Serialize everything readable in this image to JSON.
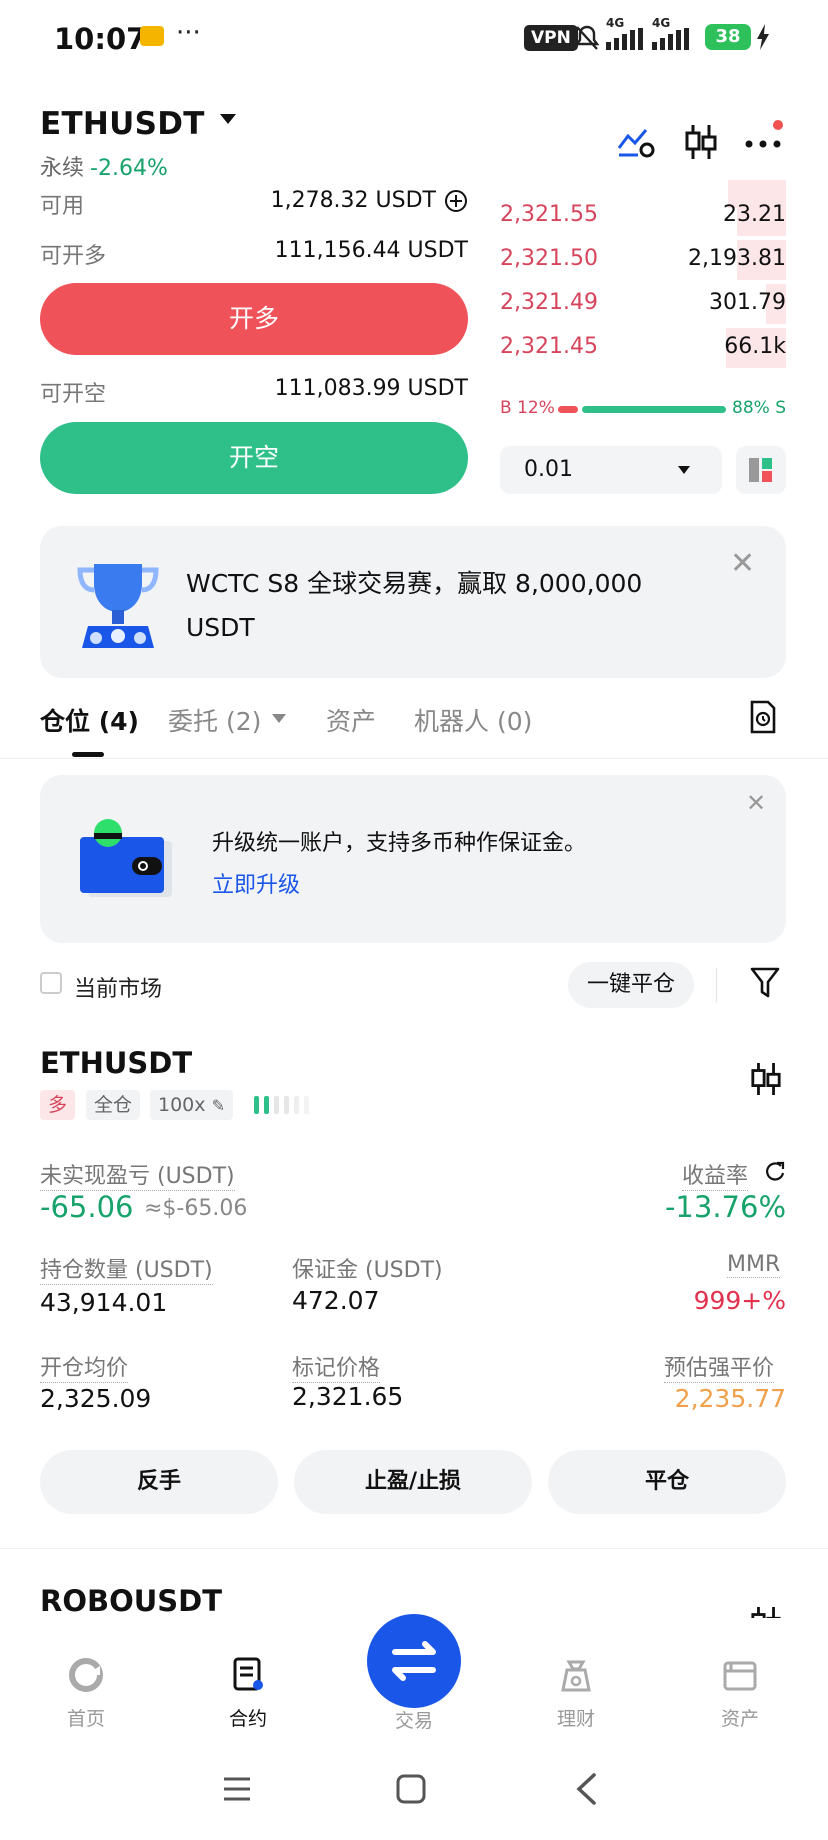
{
  "status_bar": {
    "time": "10:07",
    "more": "···",
    "vpn": "VPN",
    "net1": "4G",
    "net2": "4G",
    "battery": "38"
  },
  "header": {
    "pair": "ETHUSDT",
    "perp_label": "永续",
    "change": "-2.64%"
  },
  "balances": {
    "available_label": "可用",
    "available_value": "1,278.32 USDT",
    "can_long_label": "可开多",
    "can_long_value": "111,156.44 USDT",
    "can_short_label": "可开空",
    "can_short_value": "111,083.99 USDT"
  },
  "buttons": {
    "open_long": "开多",
    "open_short": "开空"
  },
  "orderbook": {
    "asks": [
      {
        "price": "2,321.55",
        "qty": "23.21",
        "depth": 0.17
      },
      {
        "price": "2,321.50",
        "qty": "2,193.81",
        "depth": 0.17
      },
      {
        "price": "2,321.49",
        "qty": "301.79",
        "depth": 0.07
      },
      {
        "price": "2,321.45",
        "qty": "66.1k",
        "depth": 0.21
      }
    ],
    "buy_ratio": "B 12%",
    "sell_ratio": "88% S",
    "precision": "0.01"
  },
  "promo": {
    "text": "WCTC S8 全球交易赛，赢取 8,000,000 USDT"
  },
  "tabs": [
    {
      "label": "仓位 (4)"
    },
    {
      "label": "委托 (2)"
    },
    {
      "label": "资产"
    },
    {
      "label": "机器人 (0)"
    }
  ],
  "upgrade": {
    "text": "升级统一账户，支持多币种作保证金。",
    "link": "立即升级"
  },
  "filter": {
    "current_market": "当前市场",
    "close_all": "一键平仓"
  },
  "position": {
    "symbol": "ETHUSDT",
    "side": "多",
    "margin_mode": "全仓",
    "leverage": "100x",
    "upnl_label": "未实现盈亏 (USDT)",
    "upnl_value": "-65.06",
    "upnl_approx": "≈$-65.06",
    "roe_label": "收益率",
    "roe_value": "-13.76%",
    "size_label": "持仓数量 (USDT)",
    "size_value": "43,914.01",
    "margin_label": "保证金 (USDT)",
    "margin_value": "472.07",
    "mmr_label": "MMR",
    "mmr_value": "999+%",
    "entry_label": "开仓均价",
    "entry_value": "2,325.09",
    "mark_label": "标记价格",
    "mark_value": "2,321.65",
    "liq_label": "预估强平价",
    "liq_value": "2,235.77",
    "btn_reverse": "反手",
    "btn_tpsl": "止盈/止损",
    "btn_close": "平仓"
  },
  "position2": {
    "symbol": "ROBOUSDT"
  },
  "bottom_nav": [
    {
      "label": "首页"
    },
    {
      "label": "合约"
    },
    {
      "label": "交易"
    },
    {
      "label": "理财"
    },
    {
      "label": "资产"
    }
  ],
  "colors": {
    "red": "#f0525a",
    "green": "#2fc08a",
    "blue": "#1a56e8",
    "orange": "#f0a04b"
  }
}
